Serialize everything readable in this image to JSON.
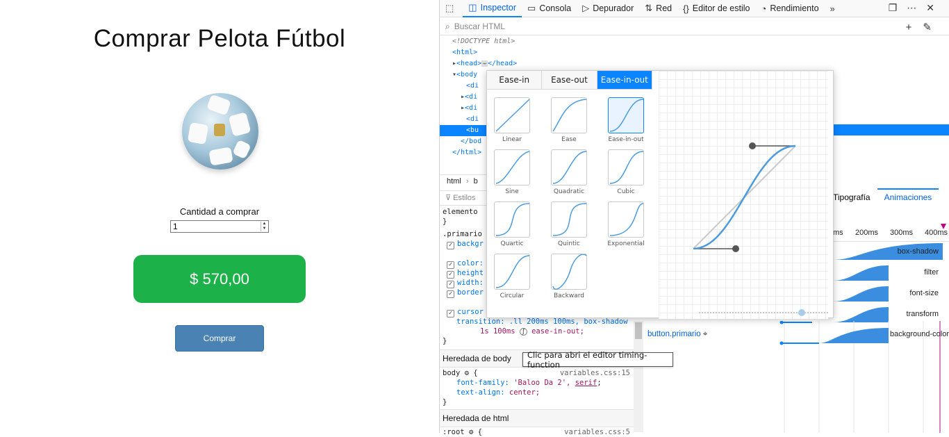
{
  "page": {
    "title": "Comprar Pelota Fútbol",
    "qty_label": "Cantidad a comprar",
    "qty_value": "1",
    "price": "$ 570,00",
    "buy_label": "Comprar"
  },
  "devtools": {
    "tabs": [
      {
        "label": "Inspector",
        "icon": "inspector-icon"
      },
      {
        "label": "Consola",
        "icon": "console-icon"
      },
      {
        "label": "Depurador",
        "icon": "debugger-icon"
      },
      {
        "label": "Red",
        "icon": "network-icon"
      },
      {
        "label": "Editor de estilo",
        "icon": "style-editor-icon"
      },
      {
        "label": "Rendimiento",
        "icon": "performance-icon"
      }
    ],
    "search_placeholder": "Buscar HTML",
    "tree": {
      "doctype": "<!DOCTYPE html>",
      "html": "<html>",
      "head": "<head>",
      "head_close": "</head>",
      "body": "<body",
      "div1": "<di",
      "div2": "<di",
      "div3": "<di",
      "div4": "<di",
      "button": "<bu",
      "body_close": "</bod",
      "html_close": "</html>"
    },
    "breadcrumb": [
      "html",
      "b"
    ],
    "styles_label": "Estilos",
    "rules": {
      "element": "elemento",
      "close1": "}",
      "primario": ".primario",
      "bg": "backgr",
      "color": "color:",
      "height": "height",
      "width": "width:",
      "border": "border",
      "cursor": "cursor",
      "transition1": "transition: .ll 200ms 100ms, box-shadow",
      "transition2": "1s 100ms",
      "transition3": "ease-in-out;",
      "close2": "}"
    },
    "inherited_body": "Heredada de body",
    "body_rule": {
      "selector": "body",
      "source": "variables.css:15",
      "font_family_prop": "font-family:",
      "font_family_val": "'Baloo Da 2',",
      "font_family_generic": "serif",
      "text_align_prop": "text-align:",
      "text_align_val": "center;",
      "close": "}"
    },
    "inherited_html": "Heredada de html",
    "root_rule": {
      "selector": ":root",
      "source": "variables.css:5"
    },
    "side_tabs": {
      "typography": "Tipografía",
      "animations": "Animaciones"
    },
    "timeline_ticks": [
      "ms",
      "200ms",
      "300ms",
      "400ms"
    ],
    "animation_node": "button.primario",
    "animations": [
      "box-shadow",
      "filter",
      "font-size",
      "transform",
      "background-color"
    ],
    "tooltip": "Clic para abri el editor timing-function",
    "easing_tabs": [
      "Ease-in",
      "Ease-out",
      "Ease-in-out"
    ],
    "presets": [
      "Linear",
      "Ease",
      "Ease-in-out",
      "Sine",
      "Quadratic",
      "Cubic",
      "Quartic",
      "Quintic",
      "Exponential",
      "Circular",
      "Backward"
    ],
    "accent": "#0a84ff"
  }
}
